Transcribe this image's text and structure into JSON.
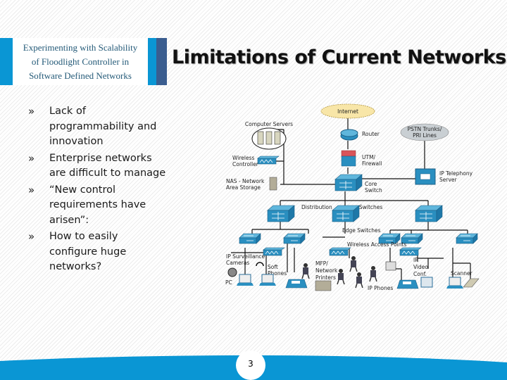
{
  "header": {
    "subtitle_lines": [
      "Experimenting with Scalability",
      "of Floodlight Controller in",
      "Software Defined Networks"
    ]
  },
  "slide": {
    "title": "Limitations of Current Networks",
    "bullet_marker": "»",
    "bullets": [
      "Lack of programmability and innovation",
      "Enterprise networks are difficult to manage",
      "“New control requirements have arisen”:",
      "How to easily configure huge networks?"
    ],
    "page_number": "3"
  },
  "diagram": {
    "labels": {
      "internet": "Internet",
      "computer_servers": "Computer Servers",
      "router": "Router",
      "pstn": [
        "PSTN Trunks/",
        "PRI Lines"
      ],
      "wireless_controller": [
        "Wireless",
        "Controller"
      ],
      "utm_firewall": [
        "UTM/",
        "Firewall"
      ],
      "ip_telephony_server": [
        "IP Telephony",
        "Server"
      ],
      "nas": [
        "NAS - Network",
        "Area Storage"
      ],
      "core_switch": [
        "Core",
        "Switch"
      ],
      "distribution_switches": [
        "Distribution",
        "Switches"
      ],
      "edge_switches": "Edge Switches",
      "wireless_access_points": "Wireless Access Points",
      "ip_surveillance_cameras": [
        "IP Surveillance",
        "Cameras"
      ],
      "soft_phones": [
        "Soft",
        "Phones"
      ],
      "mfp_printers": [
        "MFP/",
        "Network",
        "Printers"
      ],
      "ip_video_conf": [
        "IP",
        "Video",
        "Conf."
      ],
      "scanner": "Scanner",
      "pc": "PC",
      "ip_phones": "IP Phones"
    }
  },
  "colors": {
    "accent_blue": "#0a96d4",
    "dark_blue": "#3a5d8f",
    "subtitle_text": "#245a78",
    "device_blue": "#2a8fc0"
  }
}
